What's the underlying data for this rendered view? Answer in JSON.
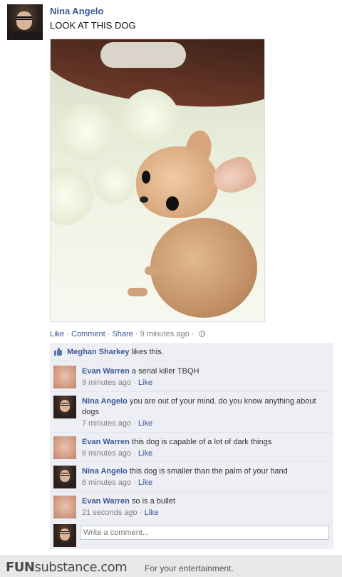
{
  "post": {
    "author": "Nina Angelo",
    "text": "LOOK AT THIS DOG",
    "actions": {
      "like": "Like",
      "comment": "Comment",
      "share": "Share",
      "time": "9 minutes ago"
    }
  },
  "likes": {
    "name": "Meghan Sharkey",
    "suffix": "likes this."
  },
  "comments": [
    {
      "author": "Evan Warren",
      "text": "a serial killer TBQH",
      "time": "9 minutes ago",
      "like": "Like"
    },
    {
      "author": "Nina Angelo",
      "text": "you are out of your mind. do you know anything about dogs",
      "time": "7 minutes ago",
      "like": "Like"
    },
    {
      "author": "Evan Warren",
      "text": "this dog is capable of a lot of dark things",
      "time": "6 minutes ago",
      "like": "Like"
    },
    {
      "author": "Nina Angelo",
      "text": "this dog is smaller than the palm of your hand",
      "time": "6 minutes ago",
      "like": "Like"
    },
    {
      "author": "Evan Warren",
      "text": "so is a bullet",
      "time": "21 seconds ago",
      "like": "Like"
    }
  ],
  "composer": {
    "placeholder": "Write a comment..."
  },
  "footer": {
    "brand_fun": "FUN",
    "brand_rest": "substance.com",
    "tagline": "For your entertainment."
  },
  "colors": {
    "link": "#3b5998",
    "comment_bg": "#edeff4"
  },
  "icons": [
    "globe-icon",
    "thumbs-up-icon"
  ]
}
